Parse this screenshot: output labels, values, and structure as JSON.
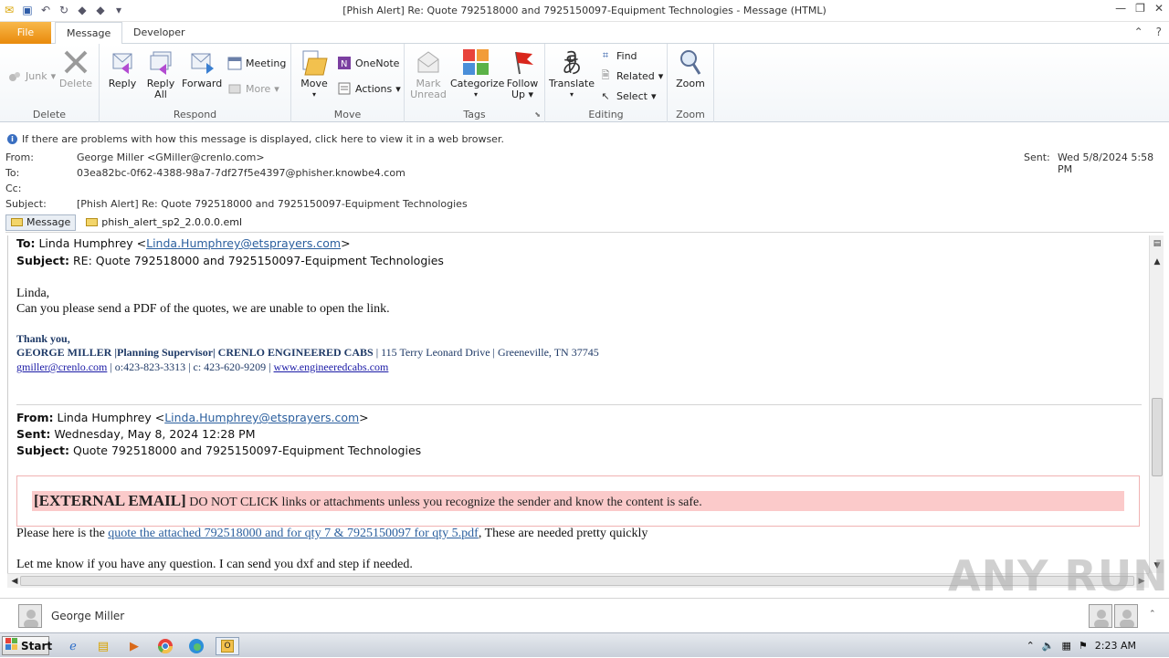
{
  "window": {
    "title": "[Phish Alert] Re: Quote 792518000 and 7925150097-Equipment Technologies  -  Message (HTML)"
  },
  "tabs": {
    "file": "File",
    "message": "Message",
    "developer": "Developer"
  },
  "ribbon": {
    "delete_group": {
      "label": "Delete",
      "junk": "Junk",
      "delete": "Delete"
    },
    "respond_group": {
      "label": "Respond",
      "reply": "Reply",
      "reply_all_1": "Reply",
      "reply_all_2": "All",
      "forward": "Forward",
      "meeting": "Meeting",
      "more": "More"
    },
    "move_group": {
      "label": "Move",
      "move": "Move",
      "onenote": "OneNote",
      "actions": "Actions"
    },
    "tags_group": {
      "label": "Tags",
      "mark_1": "Mark",
      "mark_2": "Unread",
      "categorize": "Categorize",
      "follow_1": "Follow",
      "follow_2": "Up"
    },
    "editing_group": {
      "label": "Editing",
      "translate": "Translate",
      "find": "Find",
      "related": "Related",
      "select": "Select"
    },
    "zoom_group": {
      "label": "Zoom",
      "zoom": "Zoom"
    }
  },
  "infobar": {
    "text": "If there are problems with how this message is displayed, click here to view it in a web browser."
  },
  "header": {
    "from_label": "From:",
    "from_value": "George Miller <GMiller@crenlo.com>",
    "to_label": "To:",
    "to_value": "03ea82bc-0f62-4388-98a7-7df27f5e4397@phisher.knowbe4.com",
    "cc_label": "Cc:",
    "subject_label": "Subject:",
    "subject_value": "[Phish Alert] Re: Quote 792518000 and 7925150097-Equipment Technologies",
    "sent_label": "Sent:",
    "sent_value": "Wed 5/8/2024 5:58 PM"
  },
  "attachments": {
    "message_tab": "Message",
    "eml_file": "phish_alert_sp2_2.0.0.0.eml"
  },
  "body": {
    "to_label": "To:",
    "to_name": "Linda Humphrey <",
    "to_email": "Linda.Humphrey@etsprayers.com",
    "to_close": ">",
    "subject_label": "Subject:",
    "subject_value": "RE: Quote 792518000 and 7925150097-Equipment Technologies",
    "greeting": "Linda,",
    "request": "Can you please send a PDF of the quotes, we are unable to open the link.",
    "thanks": "Thank you,",
    "sig_line1_bold": "GEORGE MILLER |Planning Supervisor| CRENLO ENGINEERED CABS",
    "sig_line1_rest": " | 115 Terry Leonard Drive | Greeneville, TN 37745",
    "sig_email": "gmiller@crenlo.com",
    "sig_phones": " | o:423-823-3313 | c: 423-620-9209 | ",
    "sig_web": "www.engineeredcabs.com",
    "q_from_label": "From:",
    "q_from_name": "Linda Humphrey <",
    "q_from_email": "Linda.Humphrey@etsprayers.com",
    "q_from_close": ">",
    "q_sent_label": "Sent:",
    "q_sent_value": "Wednesday, May 8, 2024 12:28 PM",
    "q_subject_label": "Subject:",
    "q_subject_value": "Quote 792518000 and 7925150097-Equipment Technologies",
    "external_bold": "[EXTERNAL EMAIL]",
    "external_text": " DO NOT CLICK links or attachments unless you recognize the sender and know the content is safe.",
    "please_here": "Please here is the ",
    "quote_link": "quote the attached 792518000 and for qty 7 & 7925150097 for qty 5.pdf",
    "needed": ",  These are needed pretty quickly",
    "let_me_know": "Let me know if you have any question.  I can send you dxf and step if needed."
  },
  "people_pane": {
    "name": "George Miller"
  },
  "taskbar": {
    "start": "Start",
    "clock": "2:23 AM"
  },
  "watermark": "ANY RUN"
}
